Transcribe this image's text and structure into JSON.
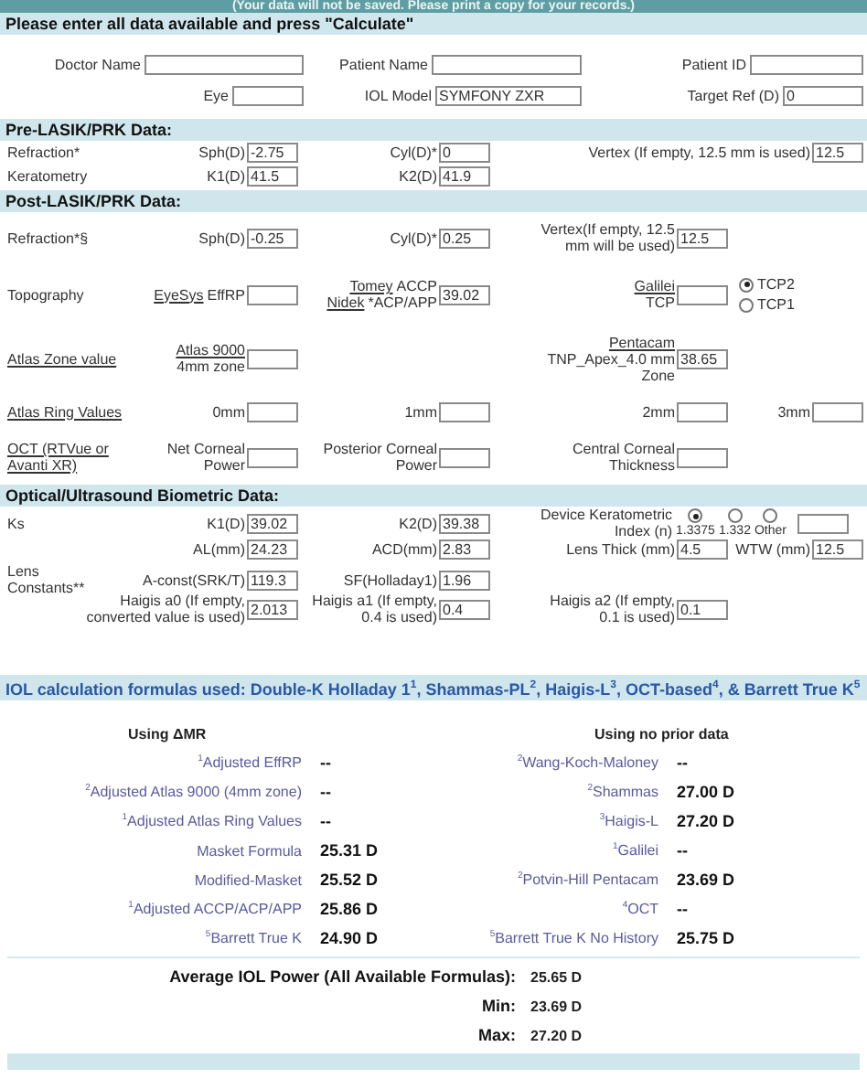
{
  "banner": "(Your data will not be saved.  Please print a copy for your records.)",
  "instructions": "Please enter all data available and press \"Calculate\"",
  "patient_fields": [
    [
      {
        "label": "Doctor Name"
      },
      {
        "label": "Patient Name"
      },
      {
        "label": "Patient ID"
      }
    ],
    [
      {
        "label": "Eye"
      },
      {
        "label": "IOL Model",
        "value": "SYMFONY ZXR"
      },
      {
        "label": "Target Ref (D)",
        "value": "0"
      }
    ]
  ],
  "sections": [
    {
      "title": "Pre-LASIK/PRK  Data:",
      "rows": [
        {
          "label": [
            [
              {
                "text": "Refraction*",
                "link": false
              }
            ]
          ],
          "cells": [
            {
              "kind": "field",
              "label": [
                [
                  {
                    "text": "Sph(D)",
                    "link": false
                  }
                ]
              ],
              "value": "-2.75"
            },
            {
              "kind": "field",
              "label": [
                [
                  {
                    "text": "Cyl(D)*",
                    "link": false
                  }
                ]
              ],
              "value": "0"
            },
            {
              "kind": "field",
              "label": [
                [
                  {
                    "text": "Vertex (If empty, 12.5 mm is used)",
                    "link": false
                  }
                ]
              ],
              "value": "12.5"
            }
          ]
        },
        {
          "label": [
            [
              {
                "text": "Keratometry",
                "link": false
              }
            ]
          ],
          "cells": [
            {
              "kind": "field",
              "label": [
                [
                  {
                    "text": "K1(D)",
                    "link": false
                  }
                ]
              ],
              "value": "41.5"
            },
            {
              "kind": "field",
              "label": [
                [
                  {
                    "text": "K2(D)",
                    "link": false
                  }
                ]
              ],
              "value": "41.9"
            }
          ]
        }
      ]
    },
    {
      "title": "Post-LASIK/PRK Data:",
      "rows": [
        {
          "label": [
            [
              {
                "text": "Refraction*§",
                "link": false
              }
            ]
          ],
          "cells": [
            {
              "kind": "field",
              "label": [
                [
                  {
                    "text": "Sph(D)",
                    "link": false
                  }
                ]
              ],
              "value": "-0.25"
            },
            {
              "kind": "field",
              "label": [
                [
                  {
                    "text": "Cyl(D)*",
                    "link": false
                  }
                ]
              ],
              "value": "0.25"
            },
            {
              "kind": "field",
              "label": [
                [
                  {
                    "text": "Vertex(If empty, 12.5",
                    "link": false
                  }
                ],
                [
                  {
                    "text": "mm will be used)",
                    "link": false
                  }
                ]
              ],
              "value": "12.5"
            }
          ]
        },
        {
          "label": [
            [
              {
                "text": "Topography",
                "link": false
              }
            ]
          ],
          "cells": [
            {
              "kind": "field",
              "label": [
                [
                  {
                    "text": "EyeSys",
                    "link": true
                  },
                  {
                    "text": "EffRP",
                    "link": false
                  }
                ]
              ]
            },
            {
              "kind": "field",
              "label": [
                [
                  {
                    "text": "Tomey",
                    "link": true
                  },
                  {
                    "text": "ACCP",
                    "link": false
                  }
                ],
                [
                  {
                    "text": "Nidek",
                    "link": true
                  },
                  {
                    "text": "*ACP/APP",
                    "link": false
                  }
                ]
              ],
              "value": "39.02"
            },
            {
              "kind": "field",
              "label": [
                [
                  {
                    "text": "Galilei",
                    "link": true
                  }
                ],
                [
                  {
                    "text": "TCP",
                    "link": false
                  }
                ]
              ]
            },
            {
              "kind": "radio",
              "options": [
                {
                  "label": "TCP2",
                  "selected": true
                },
                {
                  "label": "TCP1",
                  "selected": false
                }
              ]
            }
          ]
        },
        {
          "label": [
            [
              {
                "text": "Atlas Zone value",
                "link": true
              }
            ]
          ],
          "cells": [
            {
              "kind": "field",
              "label": [
                [
                  {
                    "text": "Atlas 9000",
                    "link": true
                  }
                ],
                [
                  {
                    "text": "4mm zone",
                    "link": false
                  }
                ]
              ]
            },
            "",
            {
              "kind": "field",
              "label": [
                [
                  {
                    "text": "Pentacam",
                    "link": true
                  }
                ],
                [
                  {
                    "text": "TNP_Apex_4.0 mm",
                    "link": false
                  }
                ],
                [
                  {
                    "text": "Zone",
                    "link": false
                  }
                ]
              ],
              "value": "38.65"
            }
          ]
        },
        {
          "label": [
            [
              {
                "text": "Atlas Ring Values",
                "link": true
              }
            ]
          ],
          "cells": [
            {
              "kind": "field",
              "label": [
                [
                  {
                    "text": "0mm",
                    "link": false
                  }
                ]
              ]
            },
            {
              "kind": "field",
              "label": [
                [
                  {
                    "text": "1mm",
                    "link": false
                  }
                ]
              ]
            },
            {
              "kind": "field",
              "label": [
                [
                  {
                    "text": "2mm",
                    "link": false
                  }
                ]
              ]
            },
            {
              "kind": "field",
              "label": [
                [
                  {
                    "text": "3mm",
                    "link": false
                  }
                ]
              ]
            }
          ]
        },
        {
          "label": [
            [
              {
                "text": "OCT (RTVue or",
                "link": true
              }
            ],
            [
              {
                "text": "Avanti XR)",
                "link": true
              }
            ]
          ],
          "cells": [
            {
              "kind": "field",
              "label": [
                [
                  {
                    "text": "Net Corneal",
                    "link": false
                  }
                ],
                [
                  {
                    "text": "Power",
                    "link": false
                  }
                ]
              ]
            },
            {
              "kind": "field",
              "label": [
                [
                  {
                    "text": "Posterior Corneal",
                    "link": false
                  }
                ],
                [
                  {
                    "text": "Power",
                    "link": false
                  }
                ]
              ]
            },
            {
              "kind": "field",
              "label": [
                [
                  {
                    "text": "Central Corneal",
                    "link": false
                  }
                ],
                [
                  {
                    "text": "Thickness",
                    "link": false
                  }
                ]
              ]
            }
          ]
        }
      ]
    },
    {
      "title": "Optical/Ultrasound Biometric Data:",
      "rows": [
        {
          "label": [
            [
              {
                "text": "Ks",
                "link": false
              }
            ]
          ],
          "cells": [
            {
              "kind": "field",
              "label": [
                [
                  {
                    "text": "K1(D)",
                    "link": false
                  }
                ]
              ],
              "value": "39.02"
            },
            {
              "kind": "field",
              "label": [
                [
                  {
                    "text": "K2(D)",
                    "link": false
                  }
                ]
              ],
              "value": "39.38"
            },
            {
              "kind": "index",
              "label": [
                [
                  {
                    "text": "Device Keratometric",
                    "link": false
                  }
                ],
                [
                  {
                    "text": "Index (n)",
                    "link": false
                  }
                ]
              ],
              "options": [
                {
                  "label": "1.3375",
                  "selected": true
                },
                {
                  "label": "1.332",
                  "selected": false
                },
                {
                  "label": "Other",
                  "selected": false
                }
              ]
            }
          ]
        },
        {
          "cells": [
            {
              "kind": "field",
              "label": [
                [
                  {
                    "text": "AL(mm)",
                    "link": false
                  }
                ]
              ],
              "value": "24.23"
            },
            {
              "kind": "field",
              "label": [
                [
                  {
                    "text": "ACD(mm)",
                    "link": false
                  }
                ]
              ],
              "value": "2.83"
            },
            {
              "kind": "field",
              "label": [
                [
                  {
                    "text": "Lens Thick (mm)",
                    "link": false
                  }
                ]
              ],
              "value": "4.5"
            },
            {
              "kind": "field",
              "label": [
                [
                  {
                    "text": "WTW (mm)",
                    "link": false
                  }
                ]
              ],
              "value": "12.5"
            }
          ]
        },
        {
          "label": [
            [
              {
                "text": "Lens",
                "link": false
              }
            ],
            [
              {
                "text": "Constants**",
                "link": false
              }
            ]
          ],
          "cells": [
            {
              "kind": "field",
              "label": [
                [
                  {
                    "text": "A-const(SRK/T)",
                    "link": false
                  }
                ]
              ],
              "value": "119.3"
            },
            {
              "kind": "field",
              "label": [
                [
                  {
                    "text": "SF(Holladay1)",
                    "link": false
                  }
                ]
              ],
              "value": "1.96"
            }
          ]
        },
        {
          "cells": [
            {
              "kind": "field",
              "label": [
                [
                  {
                    "text": "Haigis a0 (If empty,",
                    "link": false
                  }
                ],
                [
                  {
                    "text": "converted value is used)",
                    "link": false
                  }
                ]
              ],
              "value": "2.013"
            },
            {
              "kind": "field",
              "label": [
                [
                  {
                    "text": "Haigis a1 (If empty,",
                    "link": false
                  }
                ],
                [
                  {
                    "text": "0.4 is used)",
                    "link": false
                  }
                ]
              ],
              "value": "0.4"
            },
            {
              "kind": "field",
              "label": [
                [
                  {
                    "text": "Haigis a2 (If empty,",
                    "link": false
                  }
                ],
                [
                  {
                    "text": "0.1 is used)",
                    "link": false
                  }
                ]
              ],
              "value": "0.1"
            }
          ]
        }
      ]
    }
  ],
  "formulas_note": "IOL calculation formulas used: Double-K Holladay 1$^{1}$, Shammas-PL$^{2}$, Haigis-L$^{3}$, OCT-based$^{4}$, & Barrett True K$^{5}$",
  "results": [
    {
      "heading": "Using ΔMR",
      "rows": [
        {
          "formula": "$^{1}$Adjusted EffRP",
          "value": "--"
        },
        {
          "formula": "$^{2}$Adjusted Atlas 9000 (4mm zone)",
          "value": "--"
        },
        {
          "formula": "$^{1}$Adjusted Atlas Ring Values",
          "value": "--"
        },
        {
          "formula": "Masket Formula",
          "value": "25.31 D"
        },
        {
          "formula": "Modified-Masket",
          "value": "25.52 D"
        },
        {
          "formula": "$^{1}$Adjusted ACCP/ACP/APP",
          "value": "25.86 D"
        },
        {
          "formula": "$^{5}$Barrett True K",
          "value": "24.90 D"
        }
      ]
    },
    {
      "heading": "Using no prior data",
      "rows": [
        {
          "formula": "$^{2}$Wang-Koch-Maloney",
          "value": "--"
        },
        {
          "formula": "$^{2}$Shammas",
          "value": "27.00 D"
        },
        {
          "formula": "$^{3}$Haigis-L",
          "value": "27.20 D"
        },
        {
          "formula": "$^{1}$Galilei",
          "value": "--"
        },
        {
          "formula": "$^{2}$Potvin-Hill Pentacam",
          "value": "23.69 D"
        },
        {
          "formula": "$^{4}$OCT",
          "value": "--"
        },
        {
          "formula": "$^{5}$Barrett True K No History",
          "value": "25.75 D"
        }
      ]
    }
  ],
  "summary": [
    {
      "label": "Average IOL Power (All Available Formulas):",
      "value": "25.65 D"
    },
    {
      "label": "Min:",
      "value": "23.69 D"
    },
    {
      "label": "Max:",
      "value": "27.20 D"
    }
  ]
}
